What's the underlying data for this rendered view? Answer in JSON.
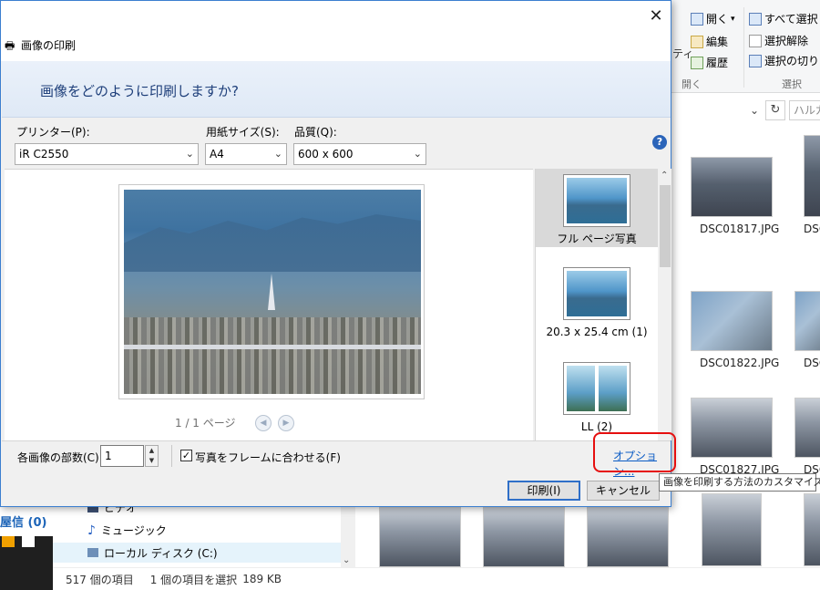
{
  "explorer": {
    "ribbon": {
      "open": "開く",
      "edit": "編集",
      "history": "履歴",
      "select_all": "すべて選択",
      "deselect": "選択解除",
      "toggle_select": "選択の切り",
      "group_open": "開く",
      "group_select": "選択",
      "partial_prop": "ティ"
    },
    "search_placeholder": "ハルカ",
    "thumbnails": [
      {
        "label": "DSC01817.JPG"
      },
      {
        "label": "DSC"
      },
      {
        "label": "DSC01822.JPG"
      },
      {
        "label": "DSC"
      },
      {
        "label": "DSC01827.JPG"
      },
      {
        "label": "DSC"
      }
    ],
    "left_fragment": "屋信 (0)",
    "nav": {
      "video": "ビデオ",
      "music": "ミュージック",
      "local_disk": "ローカル ディスク (C:)"
    },
    "status": {
      "count": "517 個の項目",
      "selected": "1 個の項目を選択",
      "size": "189 KB"
    }
  },
  "dialog": {
    "title": "画像の印刷",
    "heading": "画像をどのように印刷しますか?",
    "printer_label": "プリンター(P):",
    "printer_value": "iR C2550",
    "paper_label": "用紙サイズ(S):",
    "paper_value": "A4",
    "quality_label": "品質(Q):",
    "quality_value": "600 x 600",
    "page_counter": "1 / 1 ページ",
    "layouts": [
      {
        "label": "フル ページ写真",
        "selected": true
      },
      {
        "label": "20.3 x 25.4 cm (1)",
        "selected": false
      },
      {
        "label": "LL (2)",
        "selected": false
      }
    ],
    "copies_label": "各画像の部数(C):",
    "copies_value": "1",
    "fit_label": "写真をフレームに合わせる(F)",
    "fit_checked": true,
    "options_link": "オプション...",
    "print_button": "印刷(I)",
    "cancel_button": "キャンセル",
    "tooltip": "画像を印刷する方法のカスタマイズ"
  },
  "colors": {
    "accent": "#2f6fc8",
    "link": "#0b5cc5",
    "highlight": "#e60f0f",
    "header_bg": "#e6eef8"
  }
}
